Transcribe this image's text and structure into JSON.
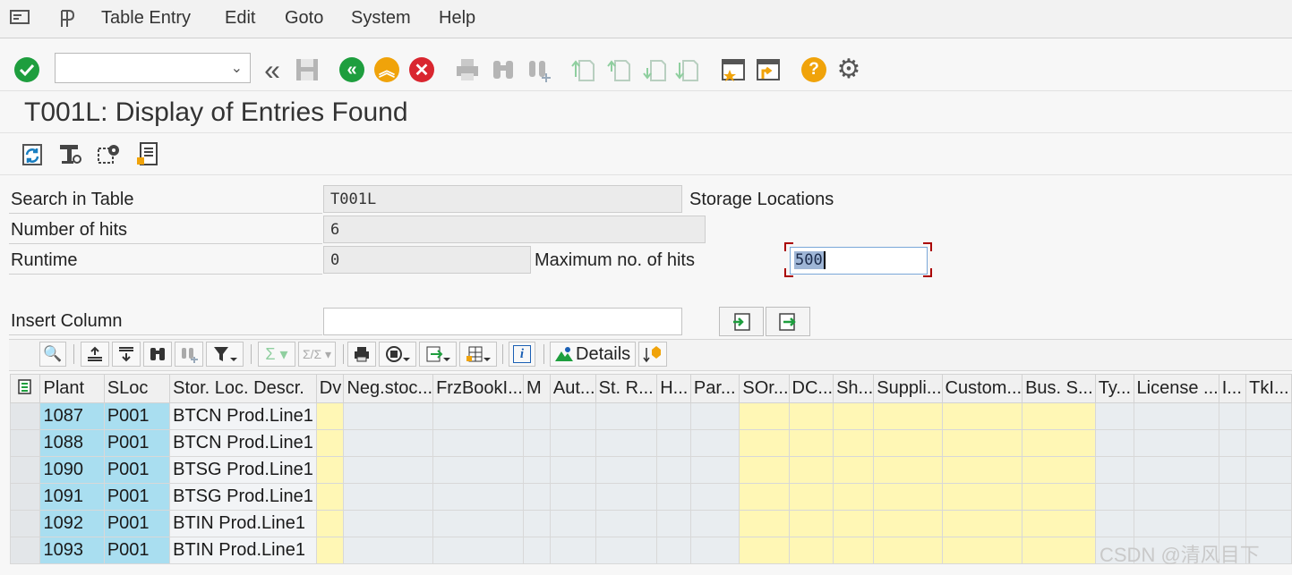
{
  "menu": {
    "items": [
      "Table Entry",
      "Edit",
      "Goto",
      "System",
      "Help"
    ]
  },
  "toolbar": {
    "command_field_value": ""
  },
  "title": "T001L: Display of Entries Found",
  "form": {
    "search_label": "Search in Table",
    "search_value": "T001L",
    "search_desc": "Storage Locations",
    "hits_label": "Number of hits",
    "hits_value": "6",
    "runtime_label": "Runtime",
    "runtime_value": "0",
    "maxhits_label": "Maximum no. of hits",
    "maxhits_value": "500",
    "insert_label": "Insert Column",
    "insert_value": ""
  },
  "alv": {
    "details_label": "Details"
  },
  "grid": {
    "columns": [
      "Plant",
      "SLoc",
      "Stor. Loc. Descr.",
      "Dv",
      "Neg.stoc...",
      "FrzBookI...",
      "M",
      "Aut...",
      "St. R...",
      "H...",
      "Par...",
      "SOr...",
      "DC...",
      "Sh...",
      "Suppli...",
      "Custom...",
      "Bus. S...",
      "Ty...",
      "License ...",
      "I...",
      "TkI..."
    ],
    "rows": [
      [
        "1087",
        "P001",
        "BTCN Prod.Line1"
      ],
      [
        "1088",
        "P001",
        "BTCN Prod.Line1"
      ],
      [
        "1090",
        "P001",
        "BTSG Prod.Line1"
      ],
      [
        "1091",
        "P001",
        "BTSG Prod.Line1"
      ],
      [
        "1092",
        "P001",
        "BTIN Prod.Line1"
      ],
      [
        "1093",
        "P001",
        "BTIN Prod.Line1"
      ]
    ]
  },
  "watermark": "CSDN @清风目下",
  "colors": {
    "key_column": "#a9def0",
    "input_column": "#fff7b5",
    "enter_green": "#1e9e3e",
    "cancel_red": "#d9262f",
    "help_orange": "#f0a30a"
  }
}
